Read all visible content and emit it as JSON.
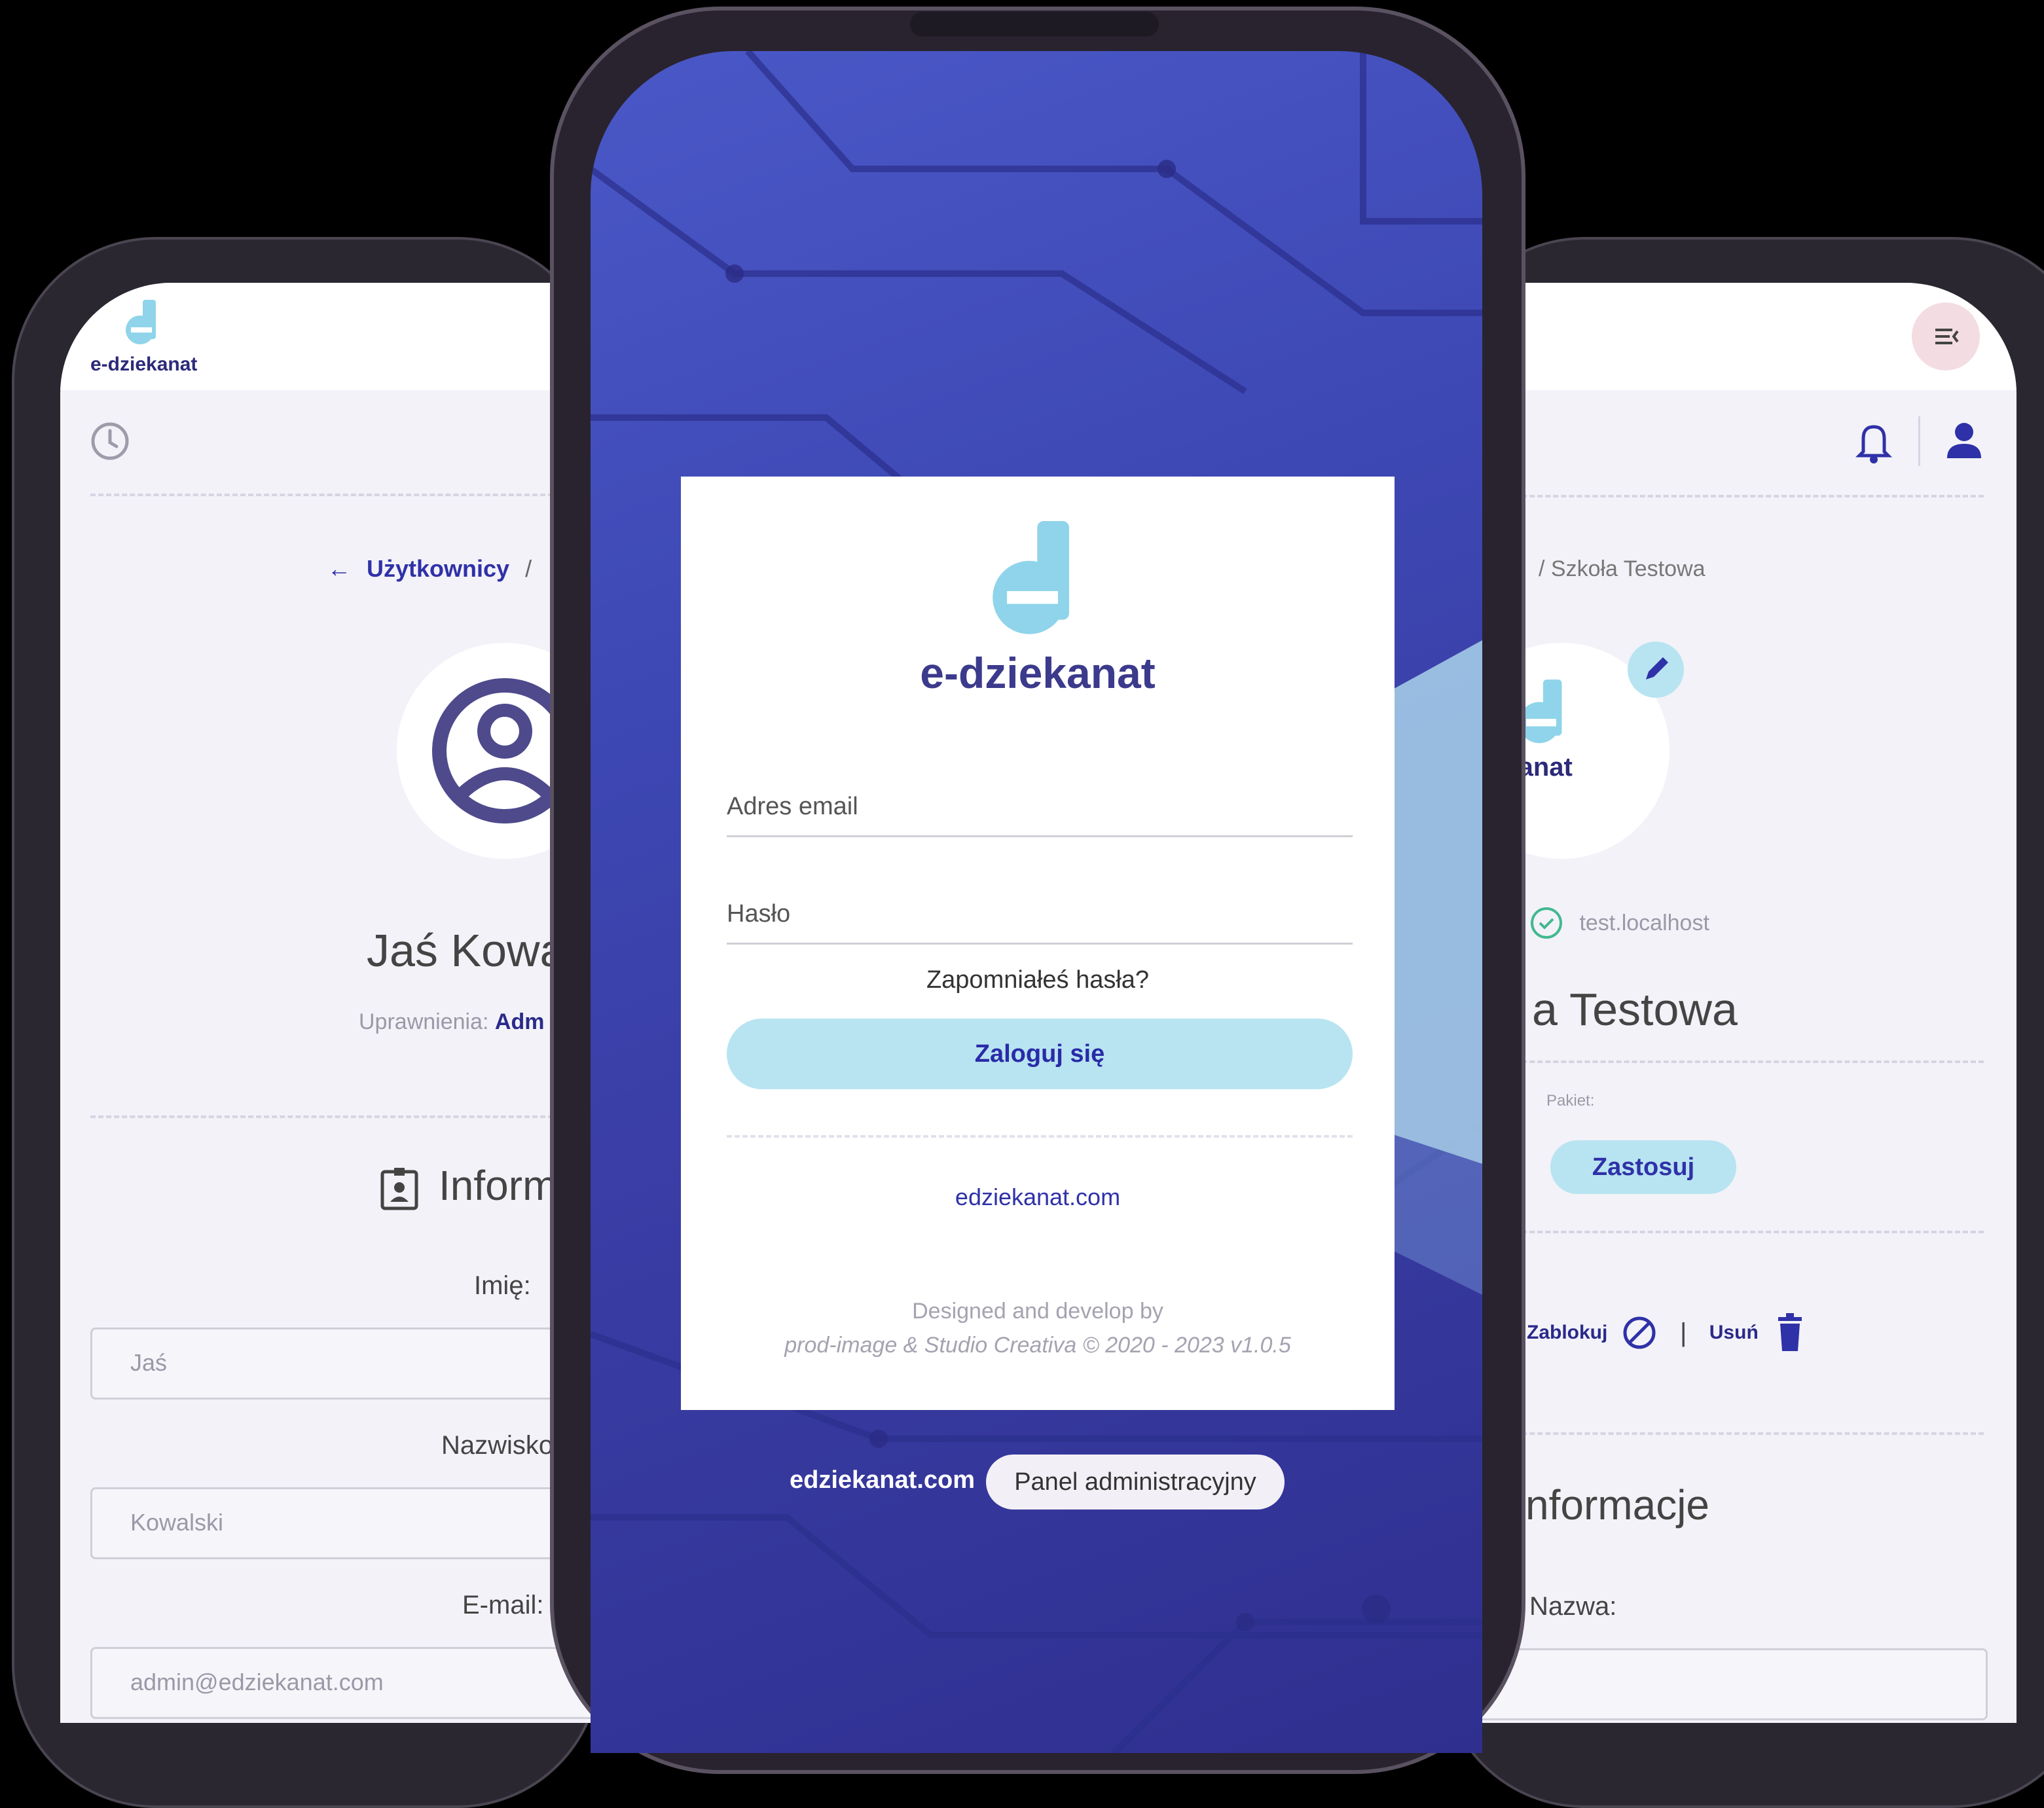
{
  "brand": "e-dziekanat",
  "colors": {
    "accent": "#2f31a8",
    "light_accent": "#b8e4f1",
    "logo_d": "#8fd4ea",
    "background": "#000000"
  },
  "left_phone": {
    "brand": "e-dziekanat",
    "breadcrumb_back": "Użytkownicy",
    "breadcrumb_sep": "/",
    "user_name": "Jaś Kowa",
    "permissions_label": "Uprawnienia:",
    "permissions_value": "Adm",
    "section_title": "Inform",
    "first_name_label": "Imię:",
    "first_name_value": "Jaś",
    "last_name_label": "Nazwisko",
    "last_name_value": "Kowalski",
    "email_label": "E-mail:",
    "email_value": "admin@edziekanat.com",
    "icons": [
      "clock-icon",
      "arrow-left-icon",
      "user-circle-icon",
      "id-badge-icon"
    ]
  },
  "login": {
    "logo_text": "e-dziekanat",
    "email_placeholder": "Adres email",
    "password_placeholder": "Hasło",
    "forgot": "Zapomniałeś hasła?",
    "submit": "Zaloguj się",
    "site_link": "edziekanat.com",
    "credits_line1": "Designed and develop by",
    "credits_line2": "prod-image & Studio Creativa © 2020 - 2023 v1.0.5",
    "footer_site": "edziekanat.com",
    "footer_button": "Panel administracyjny"
  },
  "right_phone": {
    "breadcrumb": "/ Szkoła Testowa",
    "logo_text": "ziekanat",
    "domain": "test.localhost",
    "school_name": "a Testowa",
    "package_label": "Pakiet:",
    "apply": "Zastosuj",
    "block": "Zablokuj",
    "separator": "|",
    "delete": "Usuń",
    "section_title": "nformacje",
    "name_label": "Nazwa:",
    "icons": [
      "menu-collapse-icon",
      "bell-icon",
      "user-icon",
      "pencil-icon",
      "check-circle-icon",
      "block-icon",
      "trash-icon"
    ]
  }
}
